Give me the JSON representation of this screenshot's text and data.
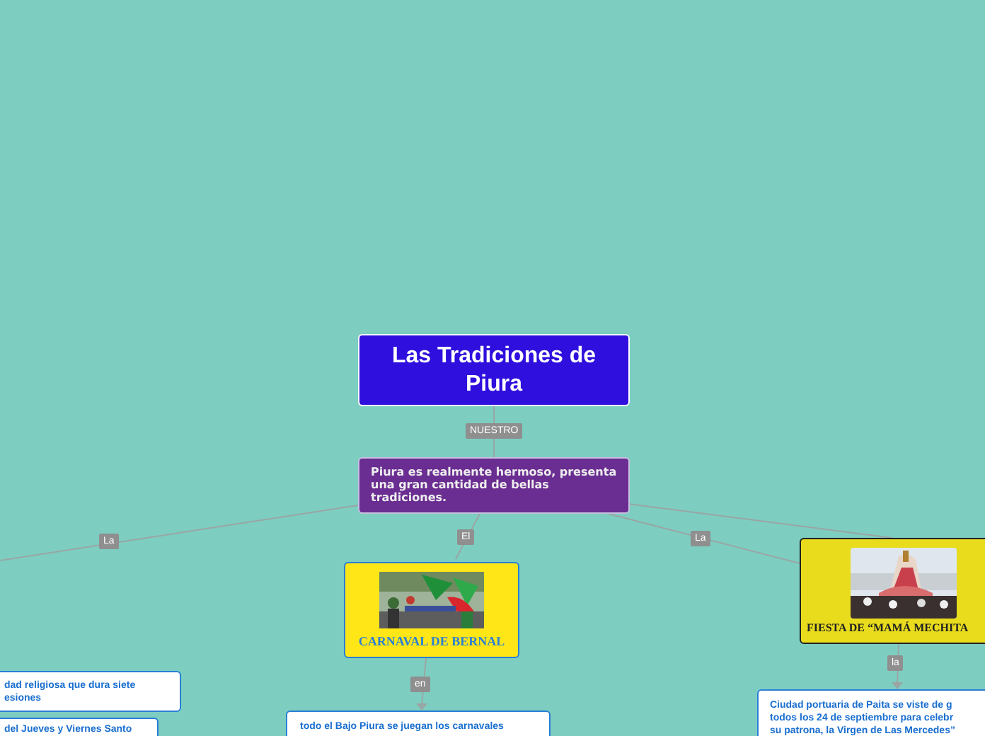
{
  "root": {
    "title": "Las Tradiciones de Piura",
    "link_label": "NUESTRO"
  },
  "center": {
    "text": "Piura es realmente hermoso, presenta una gran cantidad de bellas tradiciones."
  },
  "branches": [
    {
      "kind": "left",
      "label": "La",
      "notes": [
        {
          "lines": [
            "dad religiosa que dura siete",
            "esiones"
          ]
        },
        {
          "lines": [
            "del Jueves y Viernes Santo"
          ]
        }
      ]
    },
    {
      "kind": "topic",
      "label": "El",
      "title": "CARNAVAL DE BERNAL",
      "sub_label": "en",
      "note": {
        "lines": [
          "todo el Bajo Piura se juegan los carnavales"
        ]
      }
    },
    {
      "kind": "topic_dark",
      "label": "La",
      "title": "FIESTA DE “MAMÁ MECHITA",
      "sub_label": "la",
      "note": {
        "lines": [
          "Ciudad portuaria de Paita se viste de g",
          "todos los 24 de septiembre para celebr",
          "su patrona, la Virgen de Las Mercedes”"
        ]
      }
    }
  ]
}
